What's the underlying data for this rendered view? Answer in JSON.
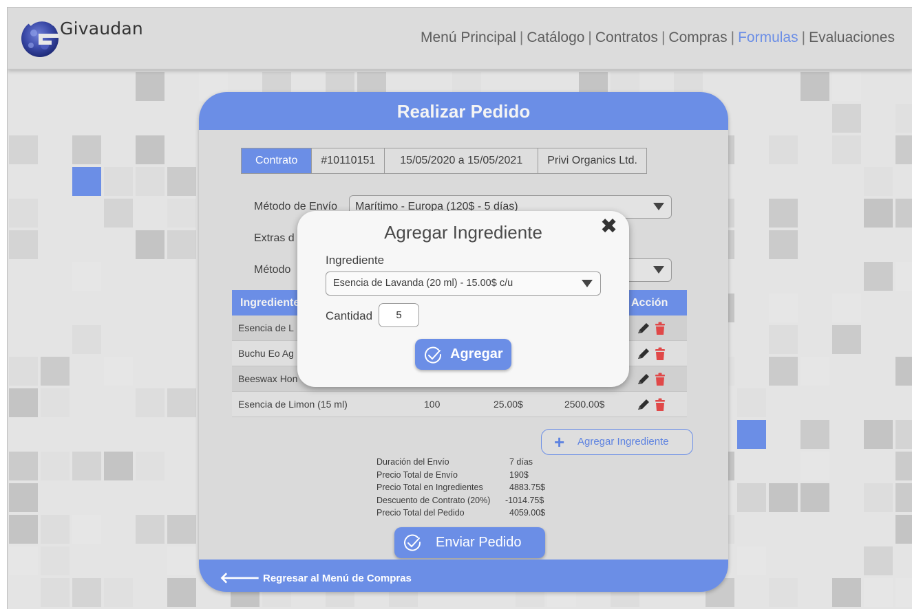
{
  "colors": {
    "accent": "#6b8ee6",
    "delete": "#e04848",
    "background_tile": "#e4e4e4"
  },
  "header": {
    "logo_text": "Givaudan",
    "nav": [
      {
        "label": "Menú Principal",
        "active": false
      },
      {
        "label": "Catálogo",
        "active": false
      },
      {
        "label": "Contratos",
        "active": false
      },
      {
        "label": "Compras",
        "active": false
      },
      {
        "label": "Formulas",
        "active": true
      },
      {
        "label": "Evaluaciones",
        "active": false
      }
    ],
    "separator": "|"
  },
  "card": {
    "title": "Realizar Pedido",
    "contract": {
      "label": "Contrato",
      "number": "#10110151",
      "period": "15/05/2020 a 15/05/2021",
      "supplier": "Privi Organics Ltd."
    },
    "shipping_method": {
      "label": "Método de Envío",
      "value": "Marítimo - Europa (120$ - 5 días)"
    },
    "extras": {
      "label": "Extras d"
    },
    "payment_method": {
      "label": "Método"
    },
    "table": {
      "headers": {
        "ingredient": "Ingrediente",
        "action": "Acción"
      },
      "rows": [
        {
          "name": "Esencia de L",
          "qty": "",
          "price": "",
          "total": ""
        },
        {
          "name": "Buchu Eo Ag",
          "qty": "",
          "price": "",
          "total": ""
        },
        {
          "name": "Beeswax Hon",
          "qty": "",
          "price": "",
          "total": ""
        },
        {
          "name": "Esencia de Limon (15 ml)",
          "qty": "100",
          "price": "25.00$",
          "total": "2500.00$"
        }
      ],
      "row_icons": [
        "pencil-icon",
        "trash-icon"
      ]
    },
    "add_ingredient_button": "Agregar Ingrediente",
    "summary": [
      {
        "label": "Duración del Envío",
        "value": "7 días"
      },
      {
        "label": "Precio Total de Envío",
        "value": "190$"
      },
      {
        "label": "Precio Total en Ingredientes",
        "value": "4883.75$"
      },
      {
        "label": "Descuento de Contrato (20%)",
        "value": "-1014.75$"
      },
      {
        "label": "Precio Total del Pedido",
        "value": "4059.00$"
      }
    ],
    "send_button": "Enviar Pedido",
    "back_link": "Regresar al Menú de Compras"
  },
  "modal": {
    "title": "Agregar Ingrediente",
    "close_glyph": "✖",
    "ingredient_label": "Ingrediente",
    "ingredient_value": "Esencia de Lavanda (20 ml) - 15.00$ c/u",
    "quantity_label": "Cantidad",
    "quantity_value": "5",
    "add_button": "Agregar"
  }
}
